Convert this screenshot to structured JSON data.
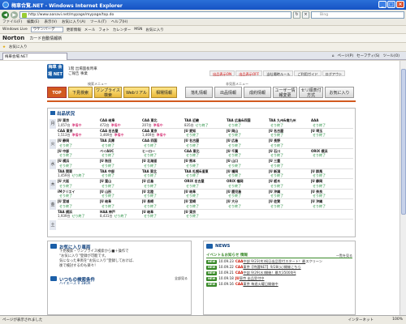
{
  "window": {
    "title": "梅車合覧.NET - Windows Internet Explorer"
  },
  "address": {
    "url": "http://www.aanavi.net/mypage/mypage/top.do",
    "search_placeholder": "Bing"
  },
  "menu": [
    "ファイル(F)",
    "編集(E)",
    "表示(V)",
    "お気に入り(A)",
    "ツール(T)",
    "ヘルプ(H)"
  ],
  "linkbar": {
    "live": "Windows Live",
    "dropdown": "ウケンバーグ",
    "items": [
      "更新情報",
      "メール",
      "フォト",
      "カレンダー",
      "MSN",
      "お気に入り"
    ]
  },
  "nortonbar": {
    "brand": "Norton",
    "card": "カード自動情報新"
  },
  "favbar": {
    "label": "お気に入り"
  },
  "tab": {
    "label": "梅車会場.NET"
  },
  "tabtools": [
    "ページ(P)",
    "セーフティ(S)",
    "ツール(O)"
  ],
  "site": {
    "logo": "梅車 会場 NET",
    "header_lines": [
      "1階 出場面板時車",
      "ご報告 事業"
    ],
    "top_buttons": [
      "出品表示ON",
      "出品表示OFF",
      "当社場時ルール",
      "ご利用ガイド",
      "ログアウト"
    ],
    "nav_label_1": "検索メニュー",
    "nav_label_2": "非見直メニュー",
    "nav": [
      "TOP",
      "下見検索",
      "ワンプライス検索",
      "Webリアル",
      "相場情報",
      "落札情報",
      "出品情報",
      "成約情報",
      "ユーザー情報変更",
      "セリ順表付方式",
      "お気に入り"
    ]
  },
  "panel": {
    "title": "出品状況",
    "days": [
      "月",
      "火",
      "水",
      "木",
      "金",
      "土"
    ],
    "rows": [
      [
        [
          "JU 東京",
          "1,057台",
          "準備中"
        ],
        [
          "CAA 岐阜",
          "472台",
          "準備中"
        ],
        [
          "CAA 東北",
          "207台",
          "準備中"
        ],
        [
          "TAA 近畿",
          "835台",
          "せり終了"
        ],
        [
          "TAA 広島&四国",
          "",
          "せり終了"
        ],
        [
          "TAA 九州&南九州",
          "",
          "せり終了"
        ],
        [
          "AAA",
          "",
          "せり終了"
        ]
      ],
      [
        [
          "CAA 東京",
          "1,513台",
          "準備中"
        ],
        [
          "CAA 名古屋",
          "3,469台",
          "準備中"
        ],
        [
          "CAA 東京",
          "1,469台",
          "準備中"
        ],
        [
          "JU 愛知",
          "",
          "せり終了"
        ],
        [
          "JU 岡山",
          "",
          "せり終了"
        ],
        [
          "JU 名古屋",
          "",
          "せり終了"
        ],
        [
          "JU 埼玉",
          "",
          "せり終了"
        ]
      ],
      [
        [
          "JU 静岡",
          "",
          "せり終了"
        ],
        [
          "TAA 兵庫",
          "",
          "せり終了"
        ],
        [
          "CAA 四国",
          "",
          "せり終了"
        ],
        [
          "JU 名古屋",
          "",
          "せり終了"
        ],
        [
          "JU 広島",
          "",
          "せり終了"
        ],
        [
          "JU 長野",
          "",
          "せり終了"
        ],
        [
          "",
          "",
          ""
        ]
      ],
      [
        [
          "JU 中部",
          "",
          "せり終了"
        ],
        [
          "ベイAUC",
          "",
          "せり終了"
        ],
        [
          "ヒーロー",
          "",
          "せり終了"
        ],
        [
          "CAA 東北",
          "",
          "せり終了"
        ],
        [
          "JU 千葉",
          "",
          "せり終了"
        ],
        [
          "JU 石川",
          "",
          "せり終了"
        ],
        [
          "ORIX 横浜",
          "",
          "せり終了"
        ]
      ],
      [
        [
          "JU 横浜",
          "",
          "せり終了"
        ],
        [
          "JU 秋田",
          "",
          "せり終了"
        ],
        [
          "JU 北海道",
          "",
          "せり終了"
        ],
        [
          "JU 熊本",
          "",
          "せり終了"
        ],
        [
          "JU 山口",
          "",
          "せり終了"
        ],
        [
          "JU 三重",
          "",
          "せり終了"
        ],
        [
          "",
          "",
          ""
        ]
      ],
      [
        [
          "TAA 関東",
          "1,459台",
          "せり終了"
        ],
        [
          "TAA 中部",
          "",
          "せり終了"
        ],
        [
          "TAA 東北",
          "",
          "せり終了"
        ],
        [
          "TAA 札幌&道東",
          "",
          "せり終了"
        ],
        [
          "JU 福岡",
          "",
          "せり終了"
        ],
        [
          "JU 新潟",
          "",
          "せり終了"
        ],
        [
          "JU 群馬",
          "",
          "せり終了"
        ]
      ],
      [
        [
          "JU 大阪",
          "",
          "せり終了"
        ],
        [
          "JU 富山",
          "",
          "せり終了"
        ],
        [
          "JU 広島",
          "",
          "せり終了"
        ],
        [
          "ORIX 名古屋",
          "",
          "せり終了"
        ],
        [
          "ORIX 福岡",
          "",
          "せり終了"
        ],
        [
          "JU 栃木",
          "",
          "せり終了"
        ],
        [
          "JU 静岡",
          "",
          "せり終了"
        ]
      ],
      [
        [
          "iMクリエイ",
          "",
          "せり終了"
        ],
        [
          "JU 山形",
          "",
          "せり終了"
        ],
        [
          "JU 北陸",
          "",
          "せり終了"
        ],
        [
          "JU 岐阜",
          "",
          "せり終了"
        ],
        [
          "JU 鹿児島",
          "",
          "せり終了"
        ],
        [
          "JU 沖縄",
          "",
          "せり終了"
        ],
        [
          "JU 奈良",
          "",
          "せり終了"
        ]
      ],
      [
        [
          "JU 宮城",
          "",
          "せり終了"
        ],
        [
          "JU 岐阜",
          "",
          "せり終了"
        ],
        [
          "JU 長崎",
          "",
          "せり終了"
        ],
        [
          "JU 宮崎",
          "",
          "せり終了"
        ],
        [
          "JU 大分",
          "",
          "せり終了"
        ],
        [
          "JU 佐賀",
          "",
          "せり終了"
        ],
        [
          "JU 沖縄",
          "",
          "せり終了"
        ]
      ],
      [
        [
          "TAA 横浜",
          "1,939台",
          "せり終了"
        ],
        [
          "HAA 神戸",
          "8,431台",
          "せり終了"
        ],
        [
          "JU 岐阜",
          "",
          "せり終了"
        ],
        [
          "JU 東京",
          "",
          "せり終了"
        ],
        [
          "",
          "",
          ""
        ],
        [
          "",
          "",
          ""
        ],
        [
          "",
          "",
          ""
        ]
      ]
    ]
  },
  "favorites_box": {
    "title": "お気に入り車両",
    "lines": [
      "下見検索・ワンプライス検索から■＋操作で",
      "“お気に入り”登録が可能です。",
      "気になった車両を“お気に入り”登録しておけば、",
      "後で検討するのも楽々！"
    ],
    "section": "いつもの検索条件",
    "link": "全部見る",
    "item": "ハイエース V 1BOX"
  },
  "news_box": {
    "title": "NEWS",
    "bar": "イベント＆お知らせ 情報",
    "more": "一覧を見る",
    "items": [
      [
        "NEW",
        "10.09.23",
        "CAA",
        "中部 9/23(木)祝日出品受付スタート！最",
        "スクリーン"
      ],
      [
        "NEW",
        "10.09.22",
        "CAA",
        "東京【特選NET】9/28(火)開催こちら",
        ""
      ],
      [
        "NEW",
        "10.09.21",
        "CAA",
        "中部 9/29(水)開催！最大35000円",
        ""
      ],
      [
        "NEW",
        "10.09.18",
        "JU",
        "東京 出品受付中",
        ""
      ],
      [
        "NEW",
        "10.09.16",
        "CAA",
        "東京 毎週火曜日開催中",
        ""
      ]
    ]
  },
  "status": {
    "text": "ページが表示されました",
    "zone": "インターネット",
    "zoom": "100%"
  }
}
